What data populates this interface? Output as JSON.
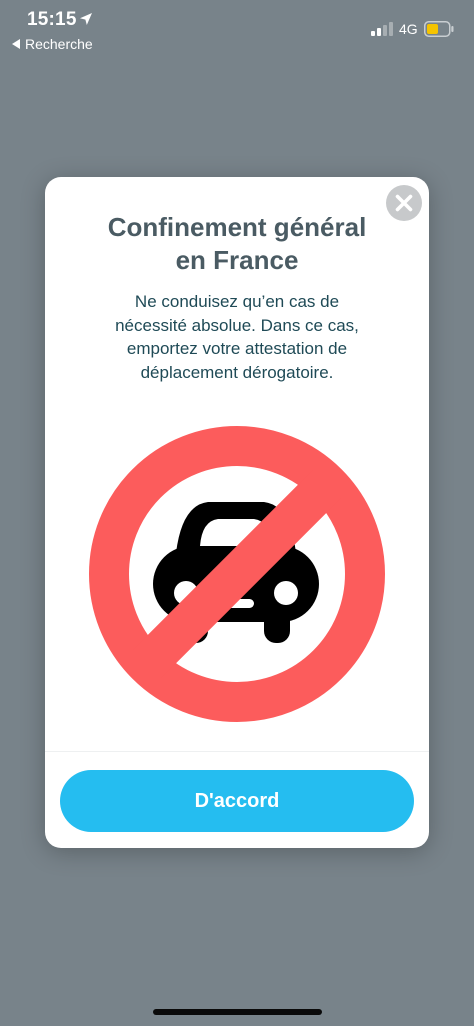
{
  "status_bar": {
    "time": "15:15",
    "back_app_label": "Recherche",
    "network": "4G",
    "icons": [
      "location-arrow-icon",
      "signal-bars-icon",
      "battery-icon"
    ]
  },
  "modal": {
    "title_line1": "Confinement général",
    "title_line2": "en France",
    "message_line1": "Ne conduisez qu’en cas de",
    "message_line2": "nécessité absolue. Dans ce cas,",
    "message_line3": "emportez votre attestation de",
    "message_line4": "déplacement dérogatoire.",
    "ok_label": "D'accord",
    "illustration": "no-car-icon",
    "close_icon": "close-icon"
  },
  "colors": {
    "backdrop": "#78838a",
    "title": "#4a5b63",
    "message": "#1f4a56",
    "prohibition_red": "#fc5c5c",
    "car": "#000000",
    "button": "#25bdf0",
    "battery_level": "#f5c400"
  }
}
